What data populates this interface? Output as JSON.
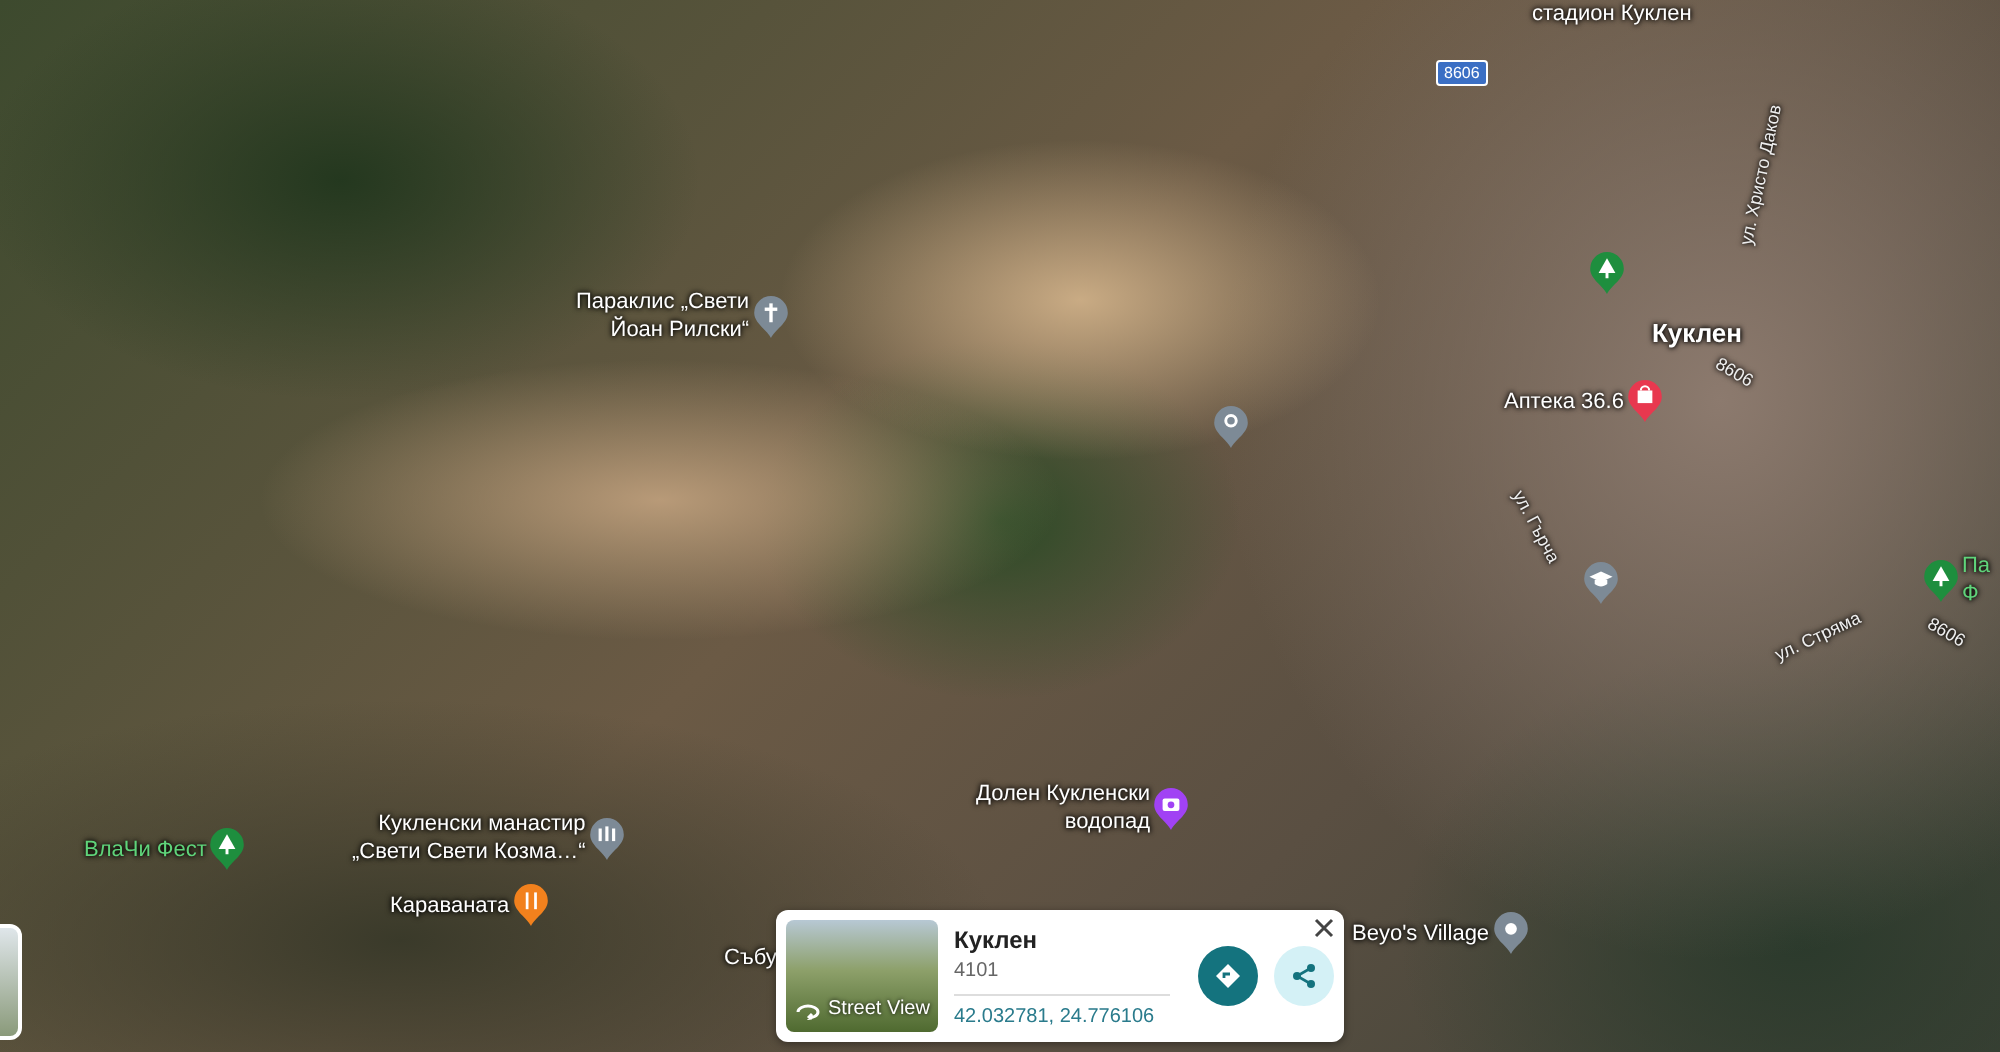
{
  "map": {
    "labels": [
      {
        "kind": "place",
        "lines": [
          "стадион Куклен"
        ]
      },
      {
        "kind": "shield",
        "lines": [
          "8606"
        ]
      },
      {
        "kind": "street",
        "lines": [
          "ул. Христо Даков"
        ]
      },
      {
        "kind": "park",
        "color": "#1e8e3e"
      },
      {
        "kind": "city",
        "lines": [
          "Куклен"
        ]
      },
      {
        "kind": "street",
        "lines": [
          "8606"
        ]
      },
      {
        "kind": "pharmacy",
        "lines": [
          "Аптека 36.6"
        ],
        "color": "#e8384f"
      },
      {
        "kind": "street",
        "lines": [
          "ул. Гърча"
        ]
      },
      {
        "kind": "school",
        "color": "#7d8a96"
      },
      {
        "kind": "park",
        "lines": [
          "Па",
          "Ф"
        ],
        "color": "#1e8e3e"
      },
      {
        "kind": "street",
        "lines": [
          "ул. Стряма"
        ]
      },
      {
        "kind": "street",
        "lines": [
          "8606"
        ]
      },
      {
        "kind": "chapel",
        "lines": [
          "Параклис „Свети",
          "Йоан Рилски“"
        ],
        "color": "#7d8a96"
      },
      {
        "kind": "marker",
        "color": "#7d8a96"
      },
      {
        "kind": "waterfall",
        "lines": [
          "Долен Кукленски",
          "водопад"
        ],
        "color": "#a142f4"
      },
      {
        "kind": "park",
        "lines": [
          "ВлаЧи Фест"
        ],
        "color": "#1e8e3e"
      },
      {
        "kind": "monastery",
        "lines": [
          "Кукленски манастир",
          "„Свети Свети Козма…“"
        ],
        "color": "#7d8a96"
      },
      {
        "kind": "restaurant",
        "lines": [
          "Караваната"
        ],
        "color": "#f2811d"
      },
      {
        "kind": "place",
        "lines": [
          "Събу"
        ]
      },
      {
        "kind": "village",
        "lines": [
          "Beyo's Village"
        ],
        "color": "#7d8a96"
      }
    ]
  },
  "place_card": {
    "photo_label": "Street View",
    "title": "Куклен",
    "subtitle": "4101",
    "coordinates": "42.032781, 24.776106"
  }
}
